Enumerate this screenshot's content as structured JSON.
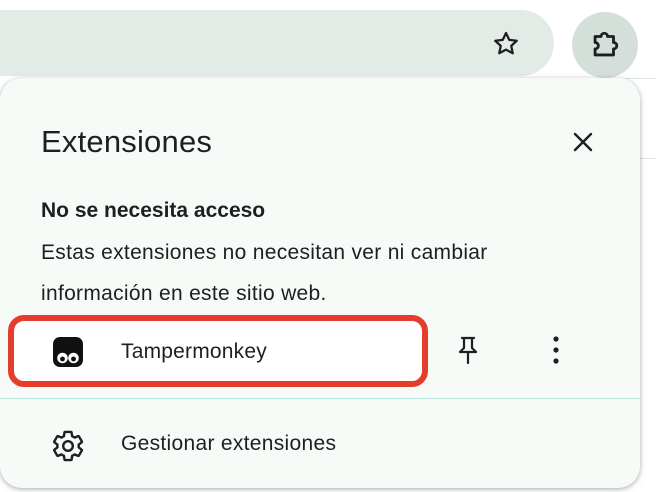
{
  "toolbar": {
    "bookmark_icon": "star-outline-icon",
    "extensions_icon": "puzzle-piece-icon"
  },
  "popup": {
    "title": "Extensiones",
    "close_icon": "close-icon",
    "section": {
      "heading": "No se necesita acceso",
      "description": "Estas extensiones no necesitan ver ni cambiar información en este sitio web."
    },
    "extensions": [
      {
        "name": "Tampermonkey",
        "icon": "tampermonkey-icon",
        "pin_icon": "pin-icon",
        "menu_icon": "more-vert-icon",
        "highlight_color": "#e53d2c"
      }
    ],
    "manage": {
      "label": "Gestionar extensiones",
      "icon": "gear-icon"
    }
  },
  "colors": {
    "popup_bg": "#f6fbf8",
    "toolbar_bg": "#e3ebe7",
    "highlight": "#e53d2c",
    "divider": "#b8e3dd"
  }
}
